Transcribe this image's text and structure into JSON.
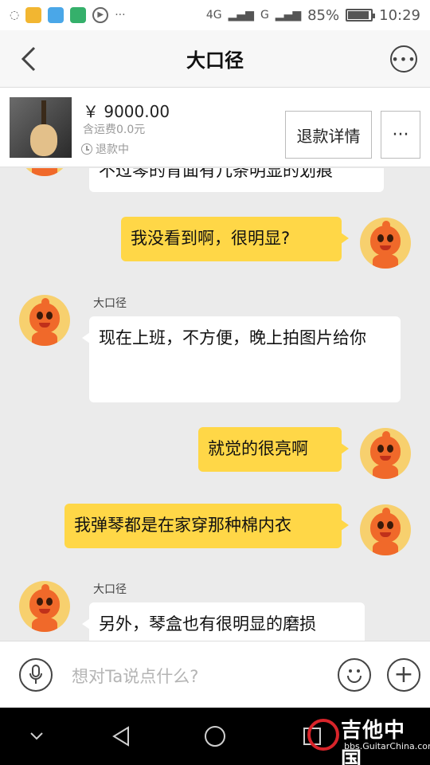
{
  "status_bar": {
    "network": "4G",
    "sim": "G",
    "battery": "85%",
    "battery_level": 0.85,
    "time": "10:29",
    "more": "···"
  },
  "header": {
    "title": "大口径"
  },
  "product": {
    "price": "￥ 9000.00",
    "shipping": "含运费0.0元",
    "status": "退款中",
    "refund_button": "退款详情",
    "more_button": "···"
  },
  "messages": [
    {
      "from": "them",
      "text": "不过琴的背面有几条明显的划痕"
    },
    {
      "from": "me",
      "text": "我没看到啊，很明显?"
    },
    {
      "from": "them",
      "sender": "大口径",
      "text": "现在上班，不方便，晚上拍图片给你"
    },
    {
      "from": "me",
      "text": "就觉的很亮啊"
    },
    {
      "from": "me",
      "text": "我弹琴都是在家穿那种棉内衣"
    },
    {
      "from": "them",
      "sender": "大口径",
      "text": "另外，琴盒也有很明显的磨损"
    }
  ],
  "input": {
    "placeholder": "想对Ta说点什么?"
  },
  "watermark": {
    "main": "吉他中国",
    "sub": "bbs.GuitarChina.com"
  },
  "colors": {
    "my_bubble": "#ffd747",
    "their_bubble": "#ffffff",
    "background": "#ebebeb"
  }
}
